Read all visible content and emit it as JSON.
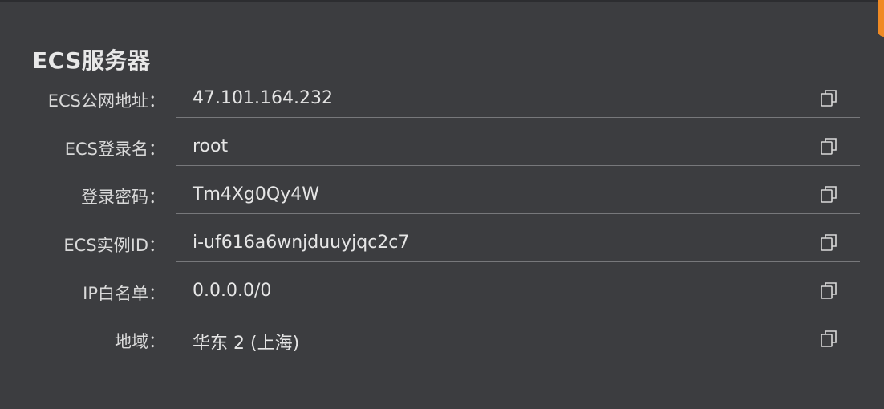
{
  "panel": {
    "title": "ECS服务器",
    "accent_color": "#f08a24",
    "rows": [
      {
        "label": "ECS公网地址：",
        "value": "47.101.164.232",
        "copy_icon": "copy-icon"
      },
      {
        "label": "ECS登录名：",
        "value": "root",
        "copy_icon": "copy-icon"
      },
      {
        "label": "登录密码：",
        "value": "Tm4Xg0Qy4W",
        "copy_icon": "copy-icon"
      },
      {
        "label": "ECS实例ID：",
        "value": "i-uf616a6wnjduuyjqc2c7",
        "copy_icon": "copy-icon"
      },
      {
        "label": "IP白名单：",
        "value": "0.0.0.0/0",
        "copy_icon": "copy-icon"
      },
      {
        "label": "地域：",
        "value": "华东 2 (上海)",
        "copy_icon": "copy-icon"
      }
    ]
  }
}
